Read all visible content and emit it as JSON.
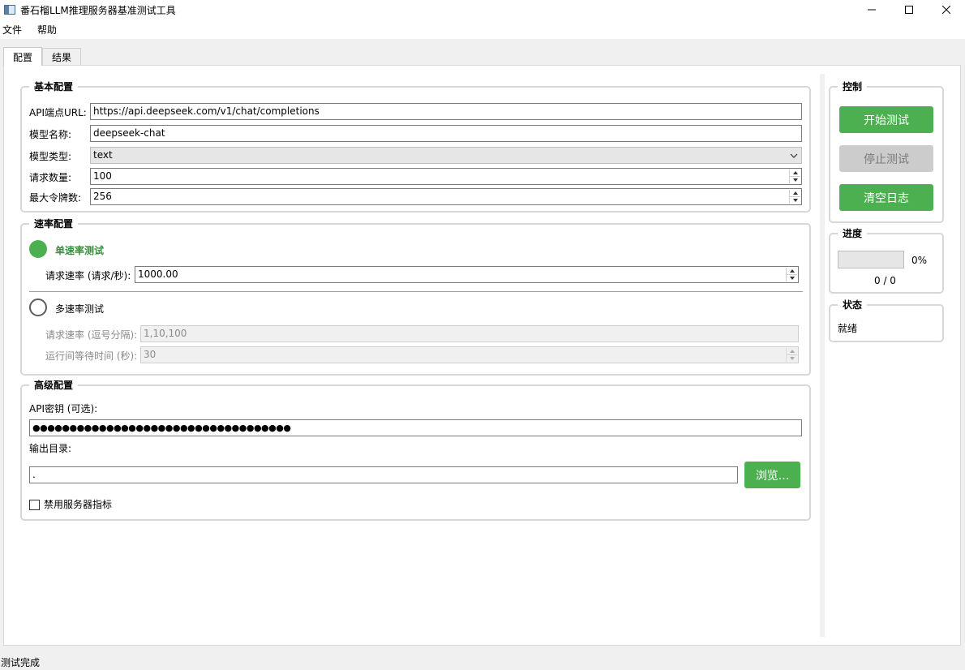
{
  "window": {
    "title": "番石榴LLM推理服务器基准测试工具"
  },
  "menu": {
    "items": [
      "文件",
      "帮助"
    ]
  },
  "tabs": [
    {
      "label": "配置",
      "active": true
    },
    {
      "label": "结果",
      "active": false
    }
  ],
  "basic_config": {
    "title": "基本配置",
    "api_url_label": "API端点URL:",
    "api_url_value": "https://api.deepseek.com/v1/chat/completions",
    "model_name_label": "模型名称:",
    "model_name_value": "deepseek-chat",
    "model_type_label": "模型类型:",
    "model_type_value": "text",
    "request_count_label": "请求数量:",
    "request_count_value": "100",
    "max_tokens_label": "最大令牌数:",
    "max_tokens_value": "256"
  },
  "rate_config": {
    "title": "速率配置",
    "single_rate_label": "单速率测试",
    "single_rate_selected": true,
    "request_rate_label": "请求速率 (请求/秒):",
    "request_rate_value": "1000.00",
    "multi_rate_label": "多速率测试",
    "multi_rate_selected": false,
    "multi_rates_label": "请求速率 (逗号分隔):",
    "multi_rates_value": "1,10,100",
    "wait_time_label": "运行间等待时间 (秒):",
    "wait_time_value": "30"
  },
  "advanced_config": {
    "title": "高级配置",
    "api_key_label": "API密钥 (可选):",
    "api_key_value": "●●●●●●●●●●●●●●●●●●●●●●●●●●●●●●●●●●●",
    "output_dir_label": "输出目录:",
    "output_dir_value": ".",
    "browse_label": "浏览...",
    "disable_metrics_label": "禁用服务器指标",
    "disable_metrics_checked": false
  },
  "control": {
    "title": "控制",
    "start_label": "开始测试",
    "stop_label": "停止测试",
    "clear_label": "清空日志"
  },
  "progress": {
    "title": "进度",
    "fraction": 0,
    "percent_text": "0%",
    "count_text": "0 / 0"
  },
  "status": {
    "title": "状态",
    "text": "就绪"
  },
  "statusbar": {
    "text": "测试完成"
  },
  "colors": {
    "accent_green": "#4caf50",
    "disabled_grey": "#cccccc"
  }
}
